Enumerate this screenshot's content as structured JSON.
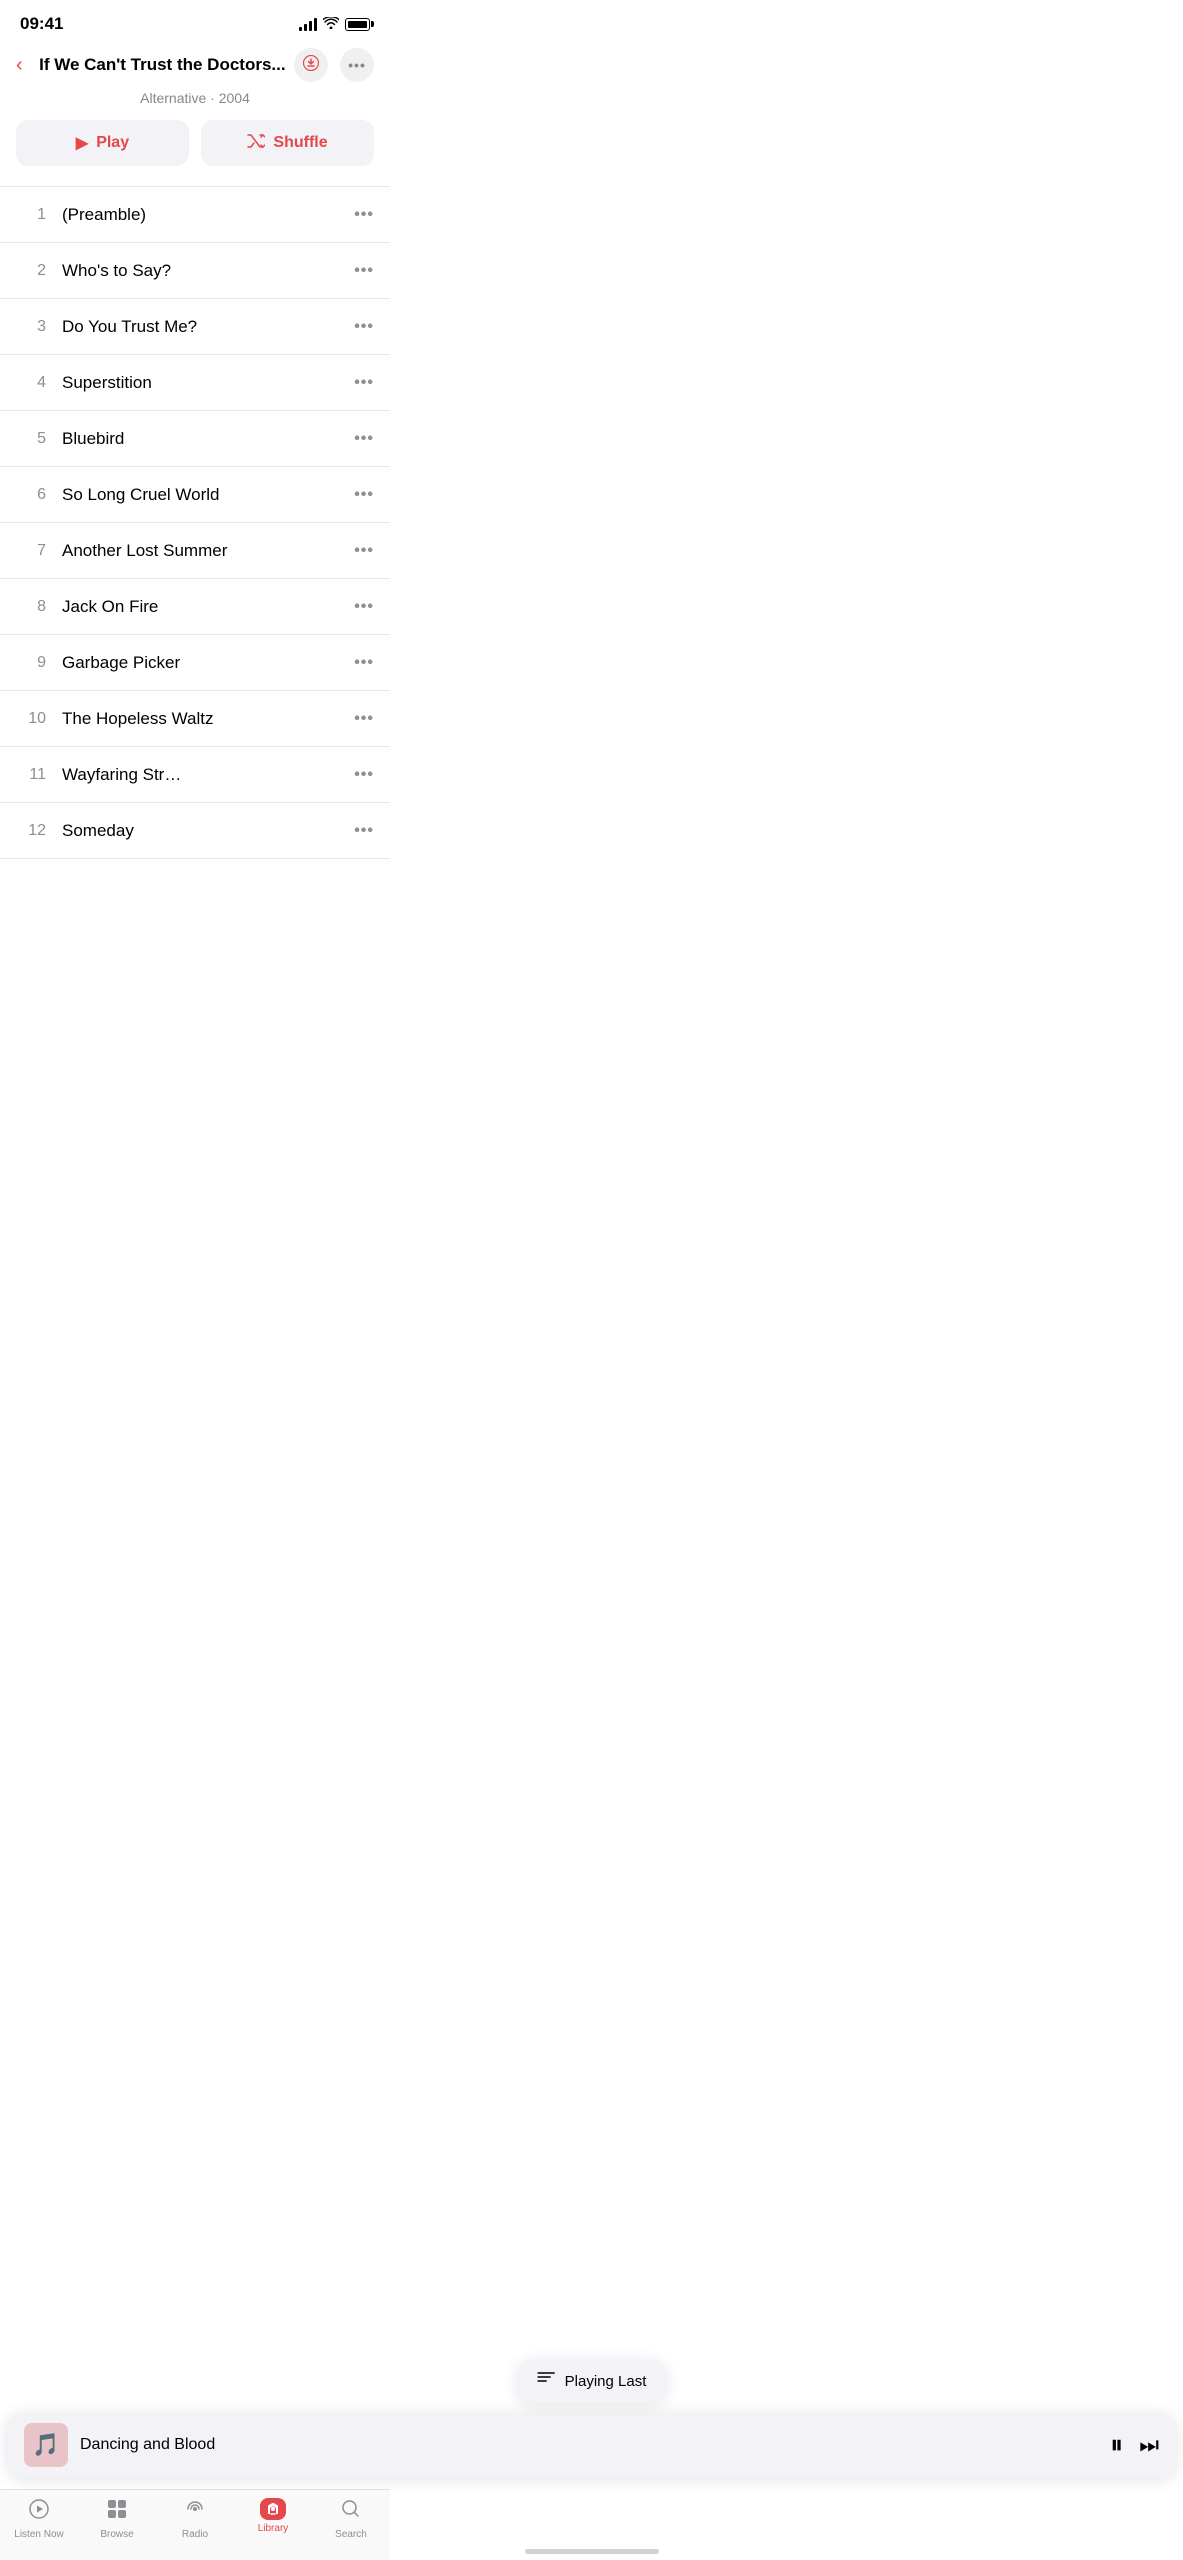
{
  "status": {
    "time": "09:41",
    "battery": 100
  },
  "header": {
    "back_label": "‹",
    "title": "If We Can't Trust the Doctors...",
    "subtitle": "Alternative · 2004"
  },
  "actions": {
    "play_label": "Play",
    "shuffle_label": "Shuffle"
  },
  "tracks": [
    {
      "number": "1",
      "name": "(Preamble)"
    },
    {
      "number": "2",
      "name": "Who's to Say?"
    },
    {
      "number": "3",
      "name": "Do You Trust Me?"
    },
    {
      "number": "4",
      "name": "Superstition"
    },
    {
      "number": "5",
      "name": "Bluebird"
    },
    {
      "number": "6",
      "name": "So Long Cruel World"
    },
    {
      "number": "7",
      "name": "Another Lost Summer"
    },
    {
      "number": "8",
      "name": "Jack On Fire"
    },
    {
      "number": "9",
      "name": "Garbage Picker"
    },
    {
      "number": "10",
      "name": "The Hopeless Waltz"
    },
    {
      "number": "11",
      "name": "Wayfaring Str…"
    },
    {
      "number": "12",
      "name": "Someday"
    }
  ],
  "tooltip": {
    "label": "Playing Last"
  },
  "now_playing": {
    "title": "Dancing and Blood",
    "art_emoji": "🎵"
  },
  "tabs": [
    {
      "id": "listen-now",
      "label": "Listen Now",
      "icon": "▶",
      "active": false
    },
    {
      "id": "browse",
      "label": "Browse",
      "icon": "⊞",
      "active": false
    },
    {
      "id": "radio",
      "label": "Radio",
      "icon": "📻",
      "active": false
    },
    {
      "id": "library",
      "label": "Library",
      "icon": "🎵",
      "active": true
    },
    {
      "id": "search",
      "label": "Search",
      "icon": "🔍",
      "active": false
    }
  ]
}
